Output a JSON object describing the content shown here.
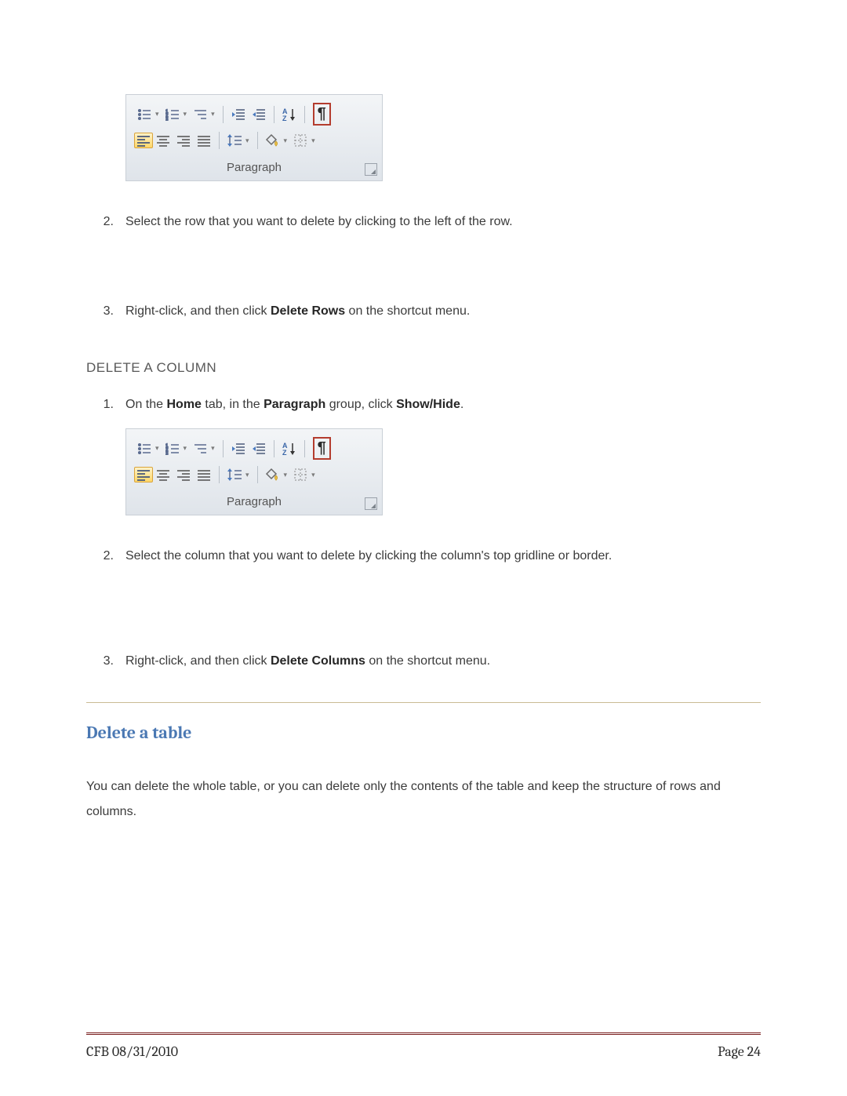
{
  "ribbon": {
    "group_label": "Paragraph"
  },
  "steps_row": {
    "s2": {
      "num": "2.",
      "text": "Select the row that you want to delete by clicking to the left of the row."
    },
    "s3": {
      "num": "3.",
      "pre": "Right-click, and then click ",
      "bold": "Delete Rows",
      "post": " on the shortcut menu."
    }
  },
  "section_col": {
    "title": "DELETE A COLUMN",
    "s1": {
      "num": "1.",
      "pre": "On the ",
      "b1": "Home",
      "mid1": " tab, in the ",
      "b2": "Paragraph",
      "mid2": " group, click ",
      "b3": "Show/Hide",
      "post": "."
    },
    "s2": {
      "num": "2.",
      "text": "Select the column that you want to delete by clicking the column's top gridline or border."
    },
    "s3": {
      "num": "3.",
      "pre": "Right-click, and then click ",
      "bold": "Delete Columns",
      "post": " on the shortcut menu."
    }
  },
  "section_table": {
    "title": "Delete a table",
    "para": "You can delete the whole table, or you can delete only the contents of the table and keep the structure of rows and columns."
  },
  "footer": {
    "left": "CFB 08/31/2010",
    "right": "Page 24"
  }
}
